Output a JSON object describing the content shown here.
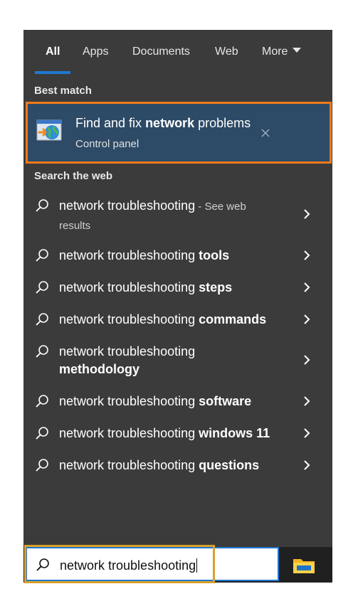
{
  "tabs": {
    "all": "All",
    "apps": "Apps",
    "documents": "Documents",
    "web": "Web",
    "more": "More"
  },
  "best_match": {
    "section_label": "Best match",
    "title_prefix": "Find and fix ",
    "title_bold": "network",
    "title_suffix": " problems",
    "subtitle": "Control panel",
    "icon": "troubleshooter-globe-icon"
  },
  "web": {
    "section_label": "Search the web",
    "results": [
      {
        "prefix": "network troubleshooting",
        "muted": " - See web",
        "muted2": "results"
      },
      {
        "prefix": "network troubleshooting ",
        "bold": "tools"
      },
      {
        "prefix": "network troubleshooting ",
        "bold": "steps"
      },
      {
        "prefix": "network troubleshooting ",
        "bold": "commands"
      },
      {
        "prefix": "network troubleshooting",
        "bold": "methodology"
      },
      {
        "prefix": "network troubleshooting ",
        "bold": "software"
      },
      {
        "prefix": "network troubleshooting ",
        "bold": "windows 11"
      },
      {
        "prefix": "network troubleshooting ",
        "bold": "questions"
      }
    ]
  },
  "search": {
    "value": "network troubleshooting"
  },
  "colors": {
    "panel": "#3b3b3b",
    "accent": "#1f78d1",
    "highlight_orange": "#f07a1a",
    "highlight_gold": "#d9a02b"
  }
}
